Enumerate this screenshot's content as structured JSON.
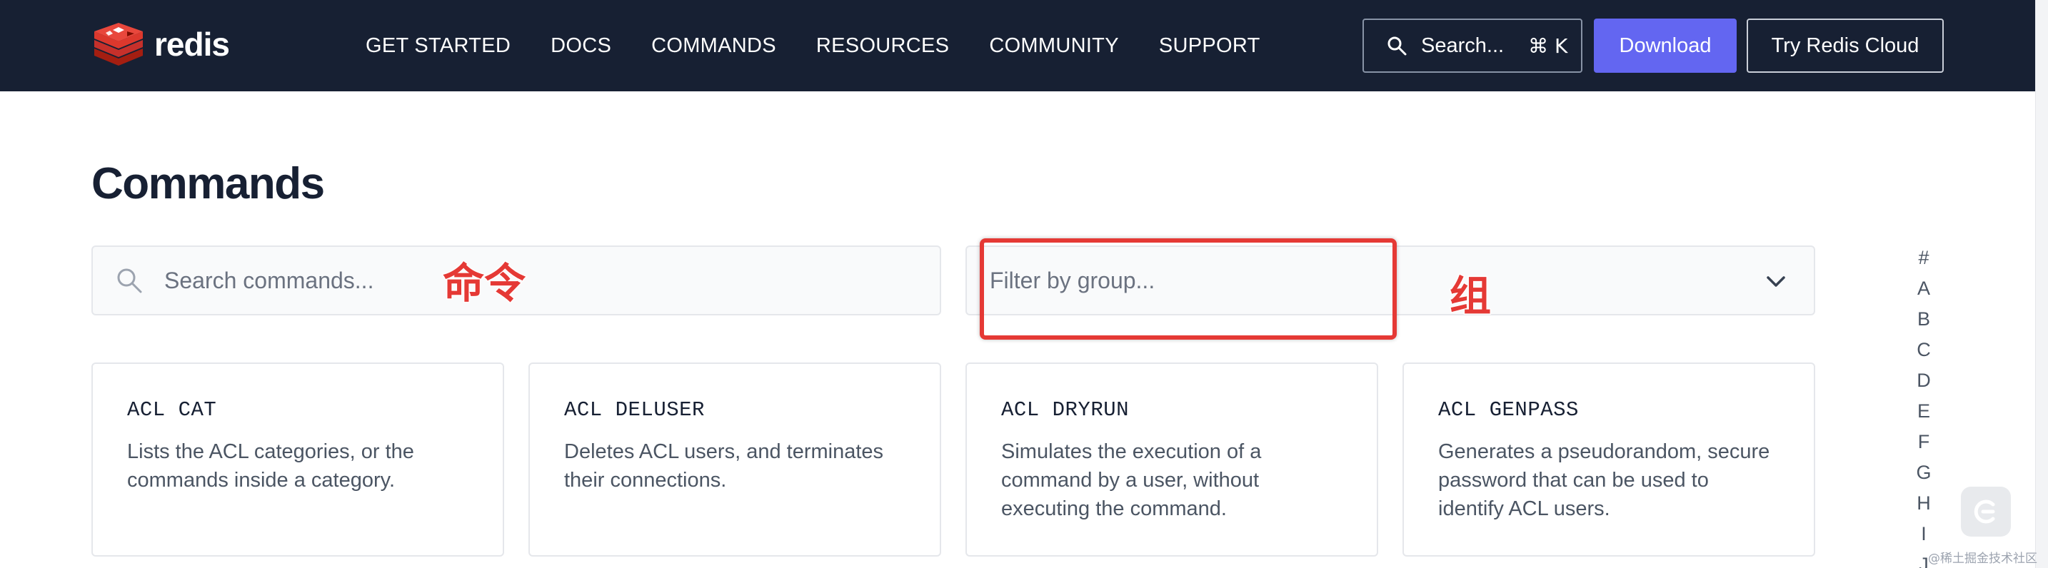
{
  "header": {
    "logo_text": "redis",
    "nav": [
      "GET STARTED",
      "DOCS",
      "COMMANDS",
      "RESOURCES",
      "COMMUNITY",
      "SUPPORT"
    ],
    "search_label": "Search...",
    "search_shortcut": "⌘ K",
    "download_label": "Download",
    "cloud_label": "Try Redis Cloud"
  },
  "page": {
    "title": "Commands",
    "search_placeholder": "Search commands...",
    "filter_placeholder": "Filter by group..."
  },
  "annotations": {
    "command_note": "命令",
    "group_note": "组",
    "highlight_color": "#e53935"
  },
  "alphabet": [
    "#",
    "A",
    "B",
    "C",
    "D",
    "E",
    "F",
    "G",
    "H",
    "I",
    "J"
  ],
  "cards": [
    {
      "title": "ACL CAT",
      "desc": "Lists the ACL categories, or the commands inside a category."
    },
    {
      "title": "ACL DELUSER",
      "desc": "Deletes ACL users, and terminates their connections."
    },
    {
      "title": "ACL DRYRUN",
      "desc": "Simulates the execution of a command by a user, without executing the command."
    },
    {
      "title": "ACL GENPASS",
      "desc": "Generates a pseudorandom, secure password that can be used to identify ACL users."
    }
  ],
  "watermark": "@稀土掘金技术社区",
  "colors": {
    "navbar": "#172033",
    "accent": "#6366f1"
  }
}
